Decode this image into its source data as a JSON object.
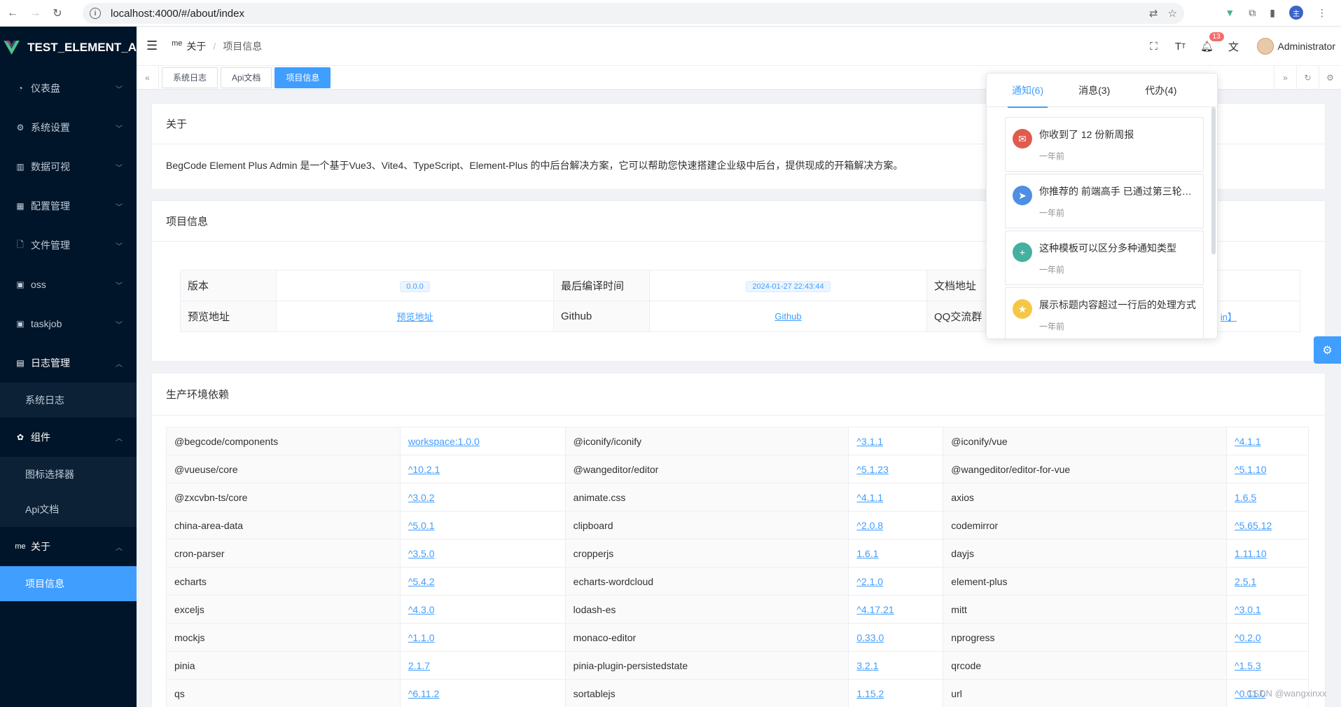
{
  "browser": {
    "url": "localhost:4000/#/about/index"
  },
  "sidebar": {
    "app_title": "TEST_ELEMENT_A",
    "items": [
      {
        "label": "仪表盘",
        "icon": "dashboard-icon"
      },
      {
        "label": "系统设置",
        "icon": "gear-icon"
      },
      {
        "label": "数据可视",
        "icon": "bar-chart-icon"
      },
      {
        "label": "配置管理",
        "icon": "config-icon"
      },
      {
        "label": "文件管理",
        "icon": "file-icon"
      },
      {
        "label": "oss",
        "icon": "storage-icon"
      },
      {
        "label": "taskjob",
        "icon": "task-icon"
      },
      {
        "label": "日志管理",
        "icon": "log-icon"
      }
    ],
    "log_sub": "系统日志",
    "components": "组件",
    "comp_sub1": "图标选择器",
    "comp_sub2": "Api文档",
    "about_prefix": "me",
    "about": "关于",
    "about_sub": "项目信息"
  },
  "header": {
    "bc_prefix": "me",
    "bc_parent": "关于",
    "bc_sep": "/",
    "bc_current": "项目信息",
    "notify_count": "13",
    "user": "Administrator"
  },
  "tags": [
    "系统日志",
    "Api文档",
    "项目信息"
  ],
  "about_card": {
    "title": "关于",
    "text": "BegCode Element Plus Admin 是一个基于Vue3、Vite4、TypeScript、Element-Plus 的中后台解决方案，它可以帮助您快速搭建企业级中后台，提供现成的开箱解决方案。"
  },
  "project_card": {
    "title": "项目信息",
    "version_label": "版本",
    "version": "0.0.0",
    "build_label": "最后编译时间",
    "build_time": "2024-01-27 22:43:44",
    "doc_label": "文档地址",
    "preview_label": "预览地址",
    "preview_link": "预览地址",
    "github_label": "Github",
    "github_link": "Github",
    "qq_label": "QQ交流群",
    "qq_link_partial": "in】"
  },
  "deps_card": {
    "title": "生产环境依赖",
    "rows": [
      [
        "@begcode/components",
        "workspace:1.0.0",
        "@iconify/iconify",
        "^3.1.1",
        "@iconify/vue",
        "^4.1.1"
      ],
      [
        "@vueuse/core",
        "^10.2.1",
        "@wangeditor/editor",
        "^5.1.23",
        "@wangeditor/editor-for-vue",
        "^5.1.10"
      ],
      [
        "@zxcvbn-ts/core",
        "^3.0.2",
        "animate.css",
        "^4.1.1",
        "axios",
        "1.6.5"
      ],
      [
        "china-area-data",
        "^5.0.1",
        "clipboard",
        "^2.0.8",
        "codemirror",
        "^5.65.12"
      ],
      [
        "cron-parser",
        "^3.5.0",
        "cropperjs",
        "1.6.1",
        "dayjs",
        "1.11.10"
      ],
      [
        "echarts",
        "^5.4.2",
        "echarts-wordcloud",
        "^2.1.0",
        "element-plus",
        "2.5.1"
      ],
      [
        "exceljs",
        "^4.3.0",
        "lodash-es",
        "^4.17.21",
        "mitt",
        "^3.0.1"
      ],
      [
        "mockjs",
        "^1.1.0",
        "monaco-editor",
        "0.33.0",
        "nprogress",
        "^0.2.0"
      ],
      [
        "pinia",
        "2.1.7",
        "pinia-plugin-persistedstate",
        "3.2.1",
        "qrcode",
        "^1.5.3"
      ],
      [
        "qs",
        "^6.11.2",
        "sortablejs",
        "1.15.2",
        "url",
        "^0.11.0"
      ]
    ]
  },
  "popover": {
    "tabs": [
      "通知(6)",
      "消息(3)",
      "代办(4)"
    ],
    "notices": [
      {
        "title": "你收到了 12 份新周报",
        "time": "一年前",
        "color": "#e05b4e",
        "icon": "mail-icon"
      },
      {
        "title": "你推荐的 前端高手 已通过第三轮面试",
        "time": "一年前",
        "color": "#4f8fe3",
        "icon": "send-icon"
      },
      {
        "title": "这种模板可以区分多种通知类型",
        "time": "一年前",
        "color": "#44b0a0",
        "icon": "plus-icon"
      },
      {
        "title": "展示标题内容超过一行后的处理方式",
        "time": "一年前",
        "color": "#f6c744",
        "icon": "star-icon"
      }
    ]
  },
  "watermark": "CSDN @wangxinxx"
}
